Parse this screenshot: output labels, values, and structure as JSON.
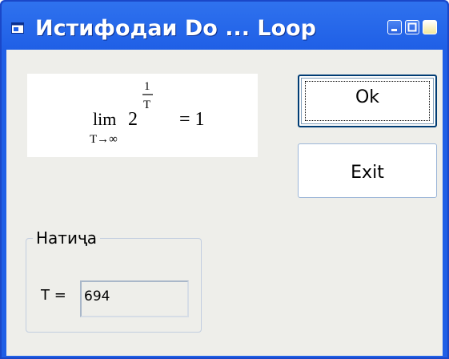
{
  "window": {
    "title": "Истифодаи Do ... Loop"
  },
  "formula": {
    "lim": "lim",
    "subscript": "T→∞",
    "base": "2",
    "exponent_numerator": "1",
    "exponent_denominator": "T",
    "rhs": "= 1"
  },
  "buttons": {
    "ok_label": "Ok",
    "exit_label": "Exit"
  },
  "result_group": {
    "legend": "Натиҷа",
    "t_label": "T =",
    "t_value": "694"
  },
  "colors": {
    "titlebar": "#1f5fe6",
    "client_background": "#eeeeea",
    "button_border": "#003c74"
  }
}
